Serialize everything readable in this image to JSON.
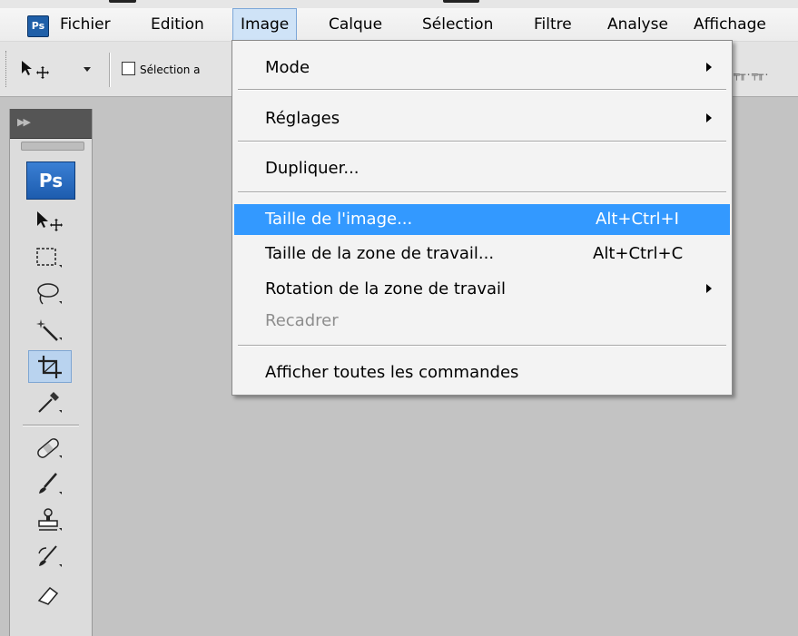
{
  "menubar": {
    "items": [
      "Fichier",
      "Edition",
      "Image",
      "Calque",
      "Sélection",
      "Filtre",
      "Analyse",
      "Affichage"
    ],
    "active": "Image"
  },
  "optionsbar": {
    "autoselect_label": "Sélection a",
    "autoselect_checked": false
  },
  "toolpanel": {
    "badge": "Ps",
    "tools": [
      "move-tool",
      "marquee-tool",
      "lasso-tool",
      "magic-wand-tool",
      "crop-tool",
      "eyedropper-tool",
      "healing-brush-tool",
      "brush-tool",
      "clone-stamp-tool",
      "history-brush-tool",
      "eraser-tool"
    ],
    "selected": "crop-tool"
  },
  "dropdown": {
    "items": [
      {
        "label": "Mode",
        "shortcut": "",
        "submenu": true,
        "disabled": false,
        "highlighted": false
      },
      {
        "label": "Réglages",
        "shortcut": "",
        "submenu": true,
        "disabled": false,
        "highlighted": false
      },
      {
        "label": "Dupliquer...",
        "shortcut": "",
        "submenu": false,
        "disabled": false,
        "highlighted": false
      },
      {
        "label": "Taille de l'image...",
        "shortcut": "Alt+Ctrl+I",
        "submenu": false,
        "disabled": false,
        "highlighted": true
      },
      {
        "label": "Taille de la zone de travail...",
        "shortcut": "Alt+Ctrl+C",
        "submenu": false,
        "disabled": false,
        "highlighted": false
      },
      {
        "label": "Rotation de la zone de travail",
        "shortcut": "",
        "submenu": true,
        "disabled": false,
        "highlighted": false
      },
      {
        "label": "Recadrer",
        "shortcut": "",
        "submenu": false,
        "disabled": true,
        "highlighted": false
      },
      {
        "label": "Afficher toutes les commandes",
        "shortcut": "",
        "submenu": false,
        "disabled": false,
        "highlighted": false
      }
    ]
  },
  "colors": {
    "highlight": "#3399ff",
    "active_menu": "#cfe3f7",
    "workspace": "#c3c3c3",
    "ps_blue": "#1f5fa8"
  }
}
